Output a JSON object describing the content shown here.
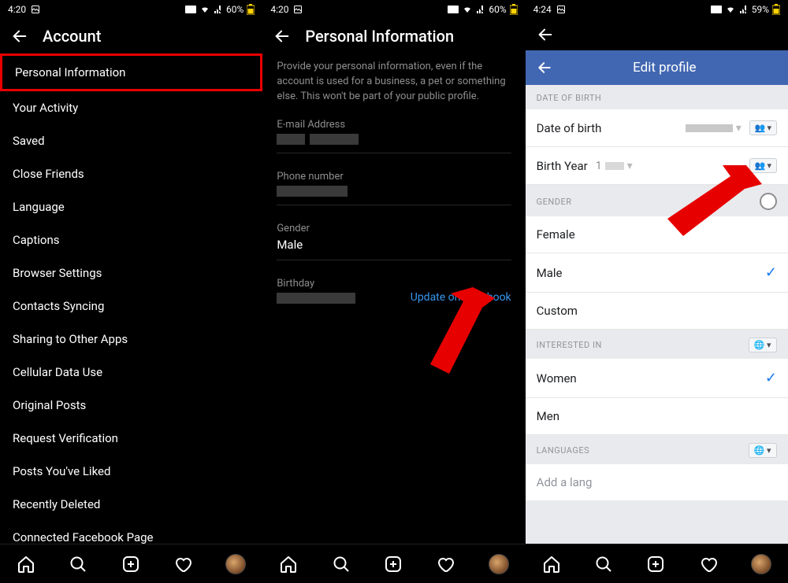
{
  "panel1": {
    "status": {
      "time": "4:20",
      "battery": "60%"
    },
    "header": {
      "title": "Account"
    },
    "menu": [
      "Personal Information",
      "Your Activity",
      "Saved",
      "Close Friends",
      "Language",
      "Captions",
      "Browser Settings",
      "Contacts Syncing",
      "Sharing to Other Apps",
      "Cellular Data Use",
      "Original Posts",
      "Request Verification",
      "Posts You've Liked",
      "Recently Deleted",
      "Connected Facebook Page"
    ]
  },
  "panel2": {
    "status": {
      "time": "4:20",
      "battery": "60%"
    },
    "header": {
      "title": "Personal Information"
    },
    "description": "Provide your personal information, even if the account is used for a business, a pet or something else. This won't be part of your public profile.",
    "fields": {
      "email_label": "E-mail Address",
      "phone_label": "Phone number",
      "gender_label": "Gender",
      "gender_value": "Male",
      "birthday_label": "Birthday",
      "update_link": "Update on Facebook"
    }
  },
  "panel3": {
    "status": {
      "time": "4:24",
      "battery": "59%"
    },
    "fb_header": {
      "title": "Edit profile"
    },
    "sections": {
      "dob_header": "DATE OF BIRTH",
      "dob_label": "Date of birth",
      "birthyear_label": "Birth Year",
      "birthyear_value": "1",
      "gender_header": "GENDER",
      "gender_options": [
        "Female",
        "Male",
        "Custom"
      ],
      "gender_selected": "Male",
      "interested_header": "INTERESTED IN",
      "interested_options": [
        "Women",
        "Men"
      ],
      "interested_selected": "Women",
      "languages_header": "LANGUAGES",
      "add_lang_placeholder": "Add a lang"
    }
  },
  "icons": {
    "privacy_friends": "👥",
    "privacy_public": "🌐",
    "caret": "▾",
    "check": "✓"
  }
}
